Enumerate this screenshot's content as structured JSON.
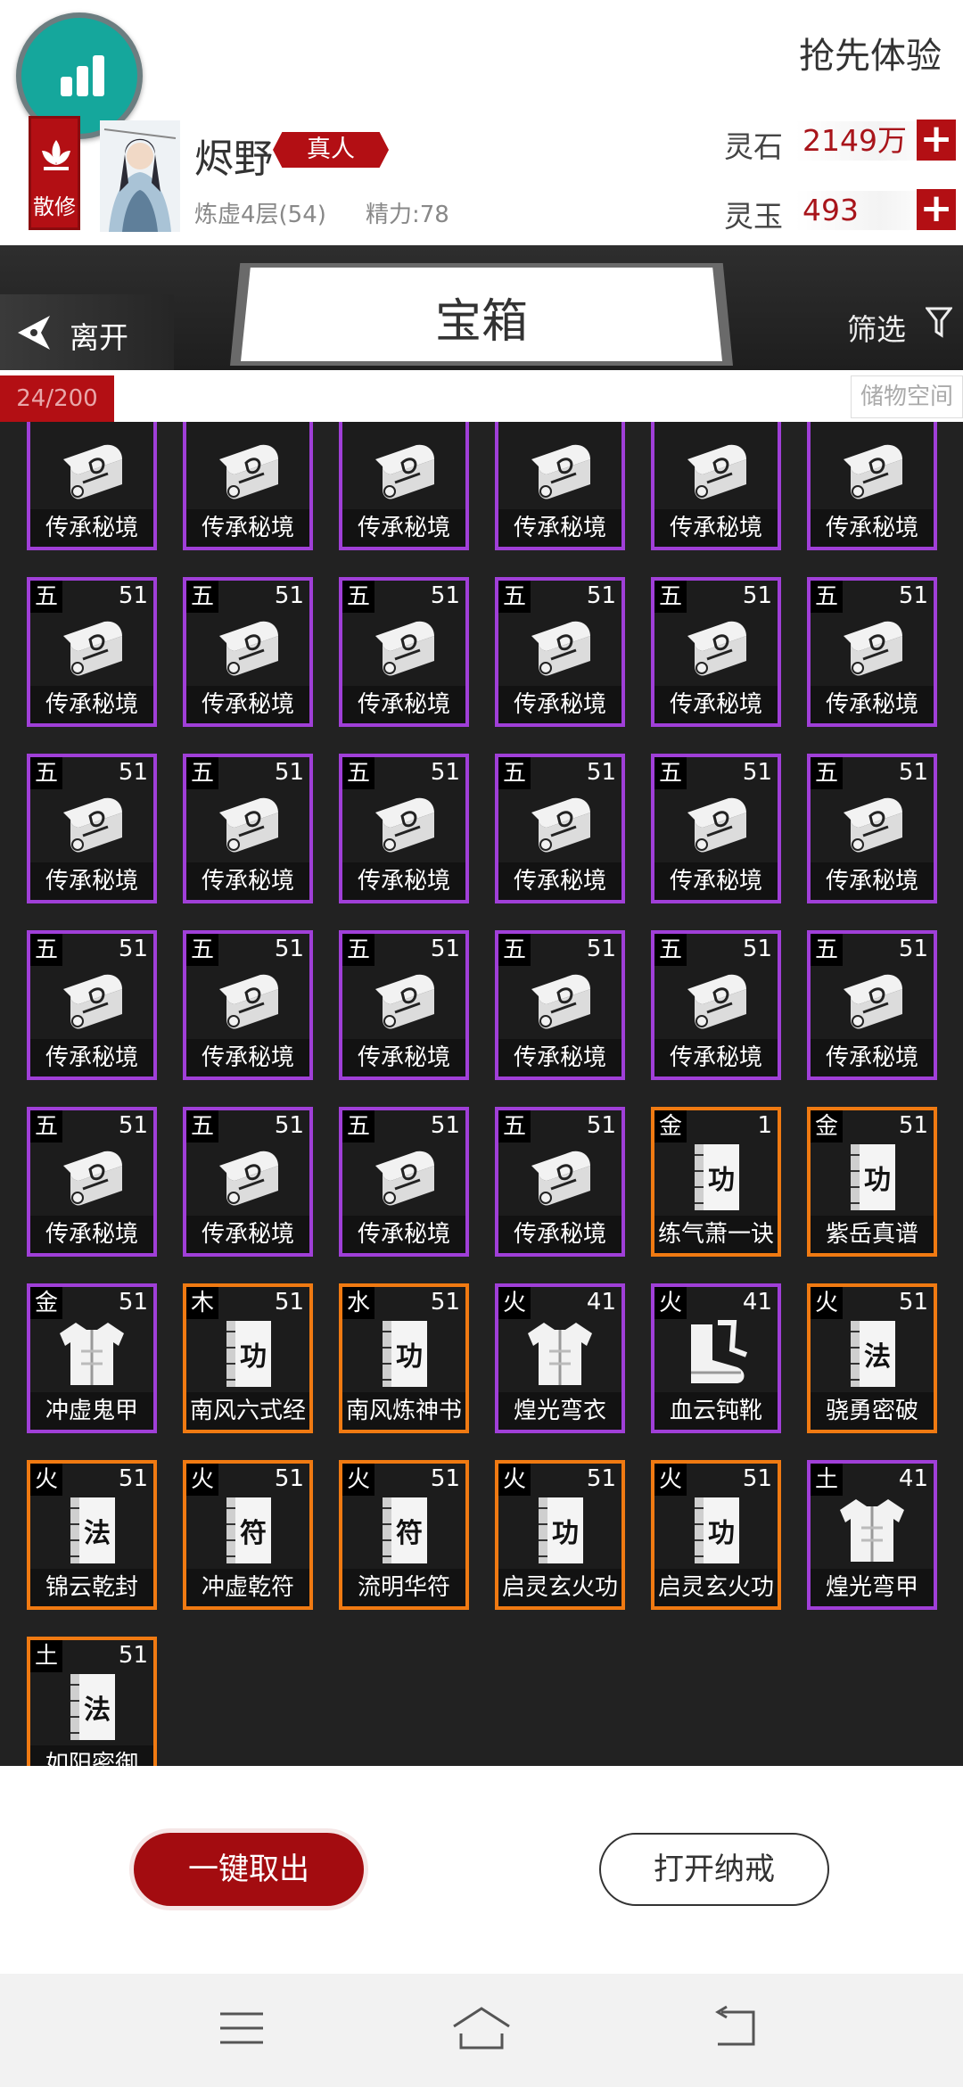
{
  "header": {
    "faction": "散修",
    "player_name": "烬野",
    "realm_tag": "真人",
    "cultivation": "炼虚4层(54)",
    "energy": "精力:78",
    "early_access": "抢先体验",
    "currencies": [
      {
        "label": "灵石",
        "value": "2149万"
      },
      {
        "label": "灵玉",
        "value": "493"
      }
    ]
  },
  "topbar": {
    "back_label": "离开",
    "title": "宝箱",
    "filter_label": "筛选"
  },
  "capacity": {
    "count": "24/200",
    "storage_label": "储物空间"
  },
  "colors": {
    "purple": "#a03fd8",
    "orange": "#f07a12",
    "brand_red": "#b30f14"
  },
  "items": [
    {
      "element": "",
      "level": "",
      "name": "传承秘境",
      "icon": "scroll-icon",
      "rarity": "purple"
    },
    {
      "element": "",
      "level": "",
      "name": "传承秘境",
      "icon": "scroll-icon",
      "rarity": "purple"
    },
    {
      "element": "",
      "level": "",
      "name": "传承秘境",
      "icon": "scroll-icon",
      "rarity": "purple"
    },
    {
      "element": "",
      "level": "",
      "name": "传承秘境",
      "icon": "scroll-icon",
      "rarity": "purple"
    },
    {
      "element": "",
      "level": "",
      "name": "传承秘境",
      "icon": "scroll-icon",
      "rarity": "purple"
    },
    {
      "element": "",
      "level": "",
      "name": "传承秘境",
      "icon": "scroll-icon",
      "rarity": "purple"
    },
    {
      "element": "五",
      "level": "51",
      "name": "传承秘境",
      "icon": "scroll-icon",
      "rarity": "purple"
    },
    {
      "element": "五",
      "level": "51",
      "name": "传承秘境",
      "icon": "scroll-icon",
      "rarity": "purple"
    },
    {
      "element": "五",
      "level": "51",
      "name": "传承秘境",
      "icon": "scroll-icon",
      "rarity": "purple"
    },
    {
      "element": "五",
      "level": "51",
      "name": "传承秘境",
      "icon": "scroll-icon",
      "rarity": "purple"
    },
    {
      "element": "五",
      "level": "51",
      "name": "传承秘境",
      "icon": "scroll-icon",
      "rarity": "purple"
    },
    {
      "element": "五",
      "level": "51",
      "name": "传承秘境",
      "icon": "scroll-icon",
      "rarity": "purple"
    },
    {
      "element": "五",
      "level": "51",
      "name": "传承秘境",
      "icon": "scroll-icon",
      "rarity": "purple"
    },
    {
      "element": "五",
      "level": "51",
      "name": "传承秘境",
      "icon": "scroll-icon",
      "rarity": "purple"
    },
    {
      "element": "五",
      "level": "51",
      "name": "传承秘境",
      "icon": "scroll-icon",
      "rarity": "purple"
    },
    {
      "element": "五",
      "level": "51",
      "name": "传承秘境",
      "icon": "scroll-icon",
      "rarity": "purple"
    },
    {
      "element": "五",
      "level": "51",
      "name": "传承秘境",
      "icon": "scroll-icon",
      "rarity": "purple"
    },
    {
      "element": "五",
      "level": "51",
      "name": "传承秘境",
      "icon": "scroll-icon",
      "rarity": "purple"
    },
    {
      "element": "五",
      "level": "51",
      "name": "传承秘境",
      "icon": "scroll-icon",
      "rarity": "purple"
    },
    {
      "element": "五",
      "level": "51",
      "name": "传承秘境",
      "icon": "scroll-icon",
      "rarity": "purple"
    },
    {
      "element": "五",
      "level": "51",
      "name": "传承秘境",
      "icon": "scroll-icon",
      "rarity": "purple"
    },
    {
      "element": "五",
      "level": "51",
      "name": "传承秘境",
      "icon": "scroll-icon",
      "rarity": "purple"
    },
    {
      "element": "五",
      "level": "51",
      "name": "传承秘境",
      "icon": "scroll-icon",
      "rarity": "purple"
    },
    {
      "element": "五",
      "level": "51",
      "name": "传承秘境",
      "icon": "scroll-icon",
      "rarity": "purple"
    },
    {
      "element": "五",
      "level": "51",
      "name": "传承秘境",
      "icon": "scroll-icon",
      "rarity": "purple"
    },
    {
      "element": "五",
      "level": "51",
      "name": "传承秘境",
      "icon": "scroll-icon",
      "rarity": "purple"
    },
    {
      "element": "五",
      "level": "51",
      "name": "传承秘境",
      "icon": "scroll-icon",
      "rarity": "purple"
    },
    {
      "element": "五",
      "level": "51",
      "name": "传承秘境",
      "icon": "scroll-icon",
      "rarity": "purple"
    },
    {
      "element": "金",
      "level": "1",
      "name": "练气萧一诀",
      "icon": "book-icon",
      "glyph": "功",
      "rarity": "orange"
    },
    {
      "element": "金",
      "level": "51",
      "name": "紫岳真谱",
      "icon": "book-icon",
      "glyph": "功",
      "rarity": "orange"
    },
    {
      "element": "金",
      "level": "51",
      "name": "冲虚鬼甲",
      "icon": "armor-icon",
      "rarity": "purple"
    },
    {
      "element": "木",
      "level": "51",
      "name": "南风六式经",
      "icon": "book-icon",
      "glyph": "功",
      "rarity": "orange"
    },
    {
      "element": "水",
      "level": "51",
      "name": "南风炼神书",
      "icon": "book-icon",
      "glyph": "功",
      "rarity": "orange"
    },
    {
      "element": "火",
      "level": "41",
      "name": "煌光弯衣",
      "icon": "armor-icon",
      "rarity": "purple"
    },
    {
      "element": "火",
      "level": "41",
      "name": "血云钝靴",
      "icon": "boots-icon",
      "rarity": "purple"
    },
    {
      "element": "火",
      "level": "51",
      "name": "骁勇密破",
      "icon": "book-icon",
      "glyph": "法",
      "rarity": "orange"
    },
    {
      "element": "火",
      "level": "51",
      "name": "锦云乾封",
      "icon": "book-icon",
      "glyph": "法",
      "rarity": "orange"
    },
    {
      "element": "火",
      "level": "51",
      "name": "冲虚乾符",
      "icon": "book-icon",
      "glyph": "符",
      "rarity": "orange"
    },
    {
      "element": "火",
      "level": "51",
      "name": "流明华符",
      "icon": "book-icon",
      "glyph": "符",
      "rarity": "orange"
    },
    {
      "element": "火",
      "level": "51",
      "name": "启灵玄火功",
      "icon": "book-icon",
      "glyph": "功",
      "rarity": "orange"
    },
    {
      "element": "火",
      "level": "51",
      "name": "启灵玄火功",
      "icon": "book-icon",
      "glyph": "功",
      "rarity": "orange"
    },
    {
      "element": "土",
      "level": "41",
      "name": "煌光弯甲",
      "icon": "armor-icon",
      "rarity": "purple"
    },
    {
      "element": "土",
      "level": "51",
      "name": "如阳密御",
      "icon": "book-icon",
      "glyph": "法",
      "rarity": "orange"
    }
  ],
  "actions": {
    "take_all": "一键取出",
    "open_ring": "打开纳戒"
  }
}
